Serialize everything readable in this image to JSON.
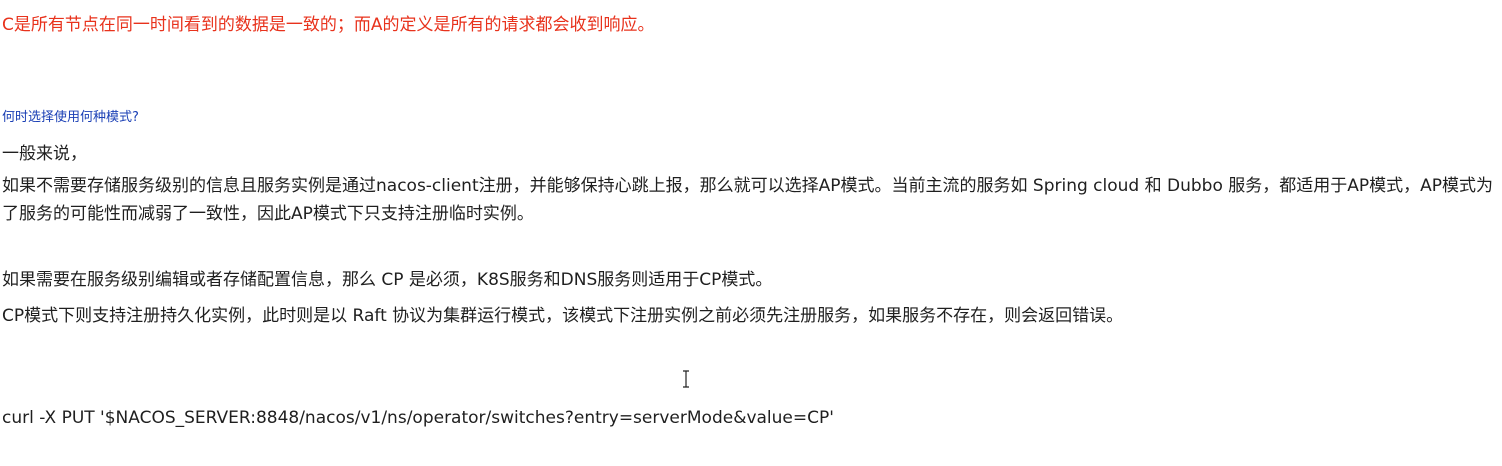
{
  "note": {
    "text": "C是所有节点在同一时间看到的数据是一致的；而A的定义是所有的请求都会收到响应。",
    "color": "#e8321c"
  },
  "question": {
    "text": "何时选择使用何种模式?",
    "color": "#1a3fb5"
  },
  "paragraphs": [
    "一般来说，",
    "如果不需要存储服务级别的信息且服务实例是通过nacos-client注册，并能够保持心跳上报，那么就可以选择AP模式。当前主流的服务如 Spring cloud 和 Dubbo 服务，都适用于AP模式，AP模式为了服务的可能性而减弱了一致性，因此AP模式下只支持注册临时实例。",
    "如果需要在服务级别编辑或者存储配置信息，那么 CP 是必须，K8S服务和DNS服务则适用于CP模式。",
    "CP模式下则支持注册持久化实例，此时则是以 Raft 协议为集群运行模式，该模式下注册实例之前必须先注册服务，如果服务不存在，则会返回错误。"
  ],
  "command": "curl -X PUT '$NACOS_SERVER:8848/nacos/v1/ns/operator/switches?entry=serverMode&value=CP'",
  "cursor_icon": "text-cursor-icon"
}
